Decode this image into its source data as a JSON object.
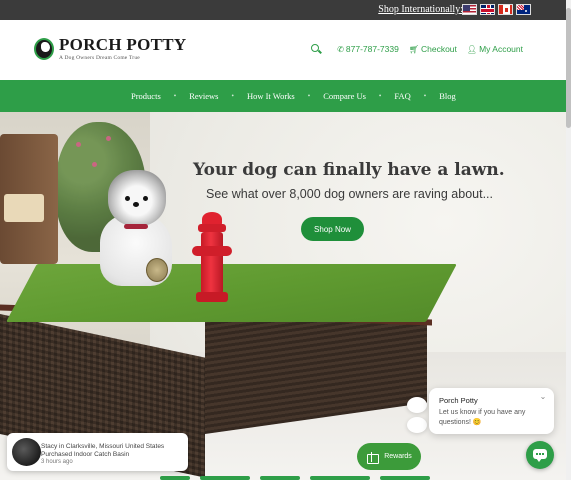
{
  "topbar": {
    "shop_label": "Shop Internationally:",
    "flags": [
      {
        "icon": "us-flag-icon"
      },
      {
        "icon": "uk-flag-icon"
      },
      {
        "icon": "canada-flag-icon"
      },
      {
        "icon": "australia-flag-icon"
      }
    ]
  },
  "header": {
    "logo_title": "PORCH POTTY",
    "logo_tagline": "A Dog Owners Dream Come True",
    "phone": "877-787-7339",
    "checkout": "Checkout",
    "account": "My Account",
    "accent_color": "#2e9e48"
  },
  "nav": {
    "items": [
      "Products",
      "Reviews",
      "How It Works",
      "Compare Us",
      "FAQ",
      "Blog"
    ],
    "background": "#2e9e48"
  },
  "hero": {
    "heading": "Your dog can finally have a lawn.",
    "subheading": "See what over 8,000 dog owners are raving about...",
    "cta": "Shop Now"
  },
  "notification": {
    "line1": "Stacy in Clarksville, Missouri United States",
    "line2": "Purchased Indoor Catch Basin",
    "line3": "3 hours ago"
  },
  "rewards": {
    "label": "Rewards"
  },
  "chat": {
    "name": "Porch Potty",
    "message": "Let us know if you have any questions! 😊"
  }
}
